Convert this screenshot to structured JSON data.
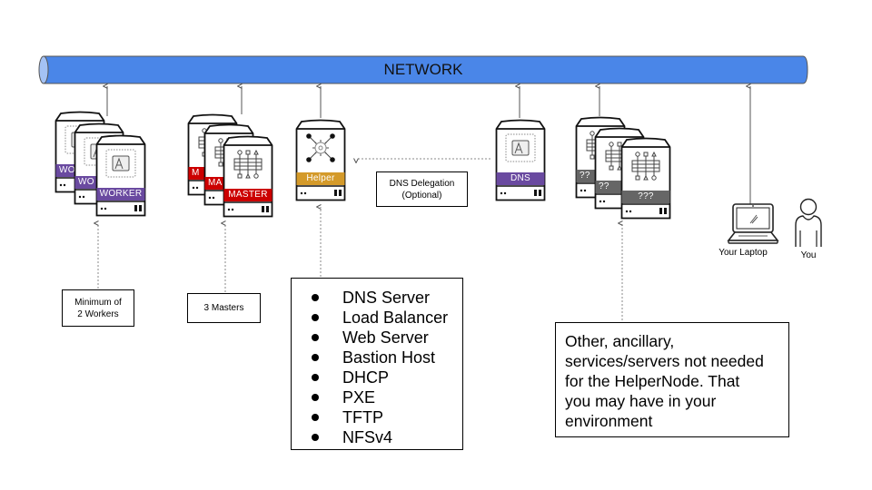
{
  "diagram": {
    "network": {
      "label": "NETWORK",
      "fill_color": "#4a86e8",
      "end_cap_color": "#a4c2f4"
    },
    "nodes": {
      "workers": {
        "label": "WORKER",
        "partial_labels": [
          "WO",
          "WO"
        ],
        "count_shown": 3,
        "band_color": "#6a4aa0",
        "icon": "container-app-icon"
      },
      "masters": {
        "label": "MASTER",
        "partial_labels": [
          "M",
          "MA"
        ],
        "count_shown": 3,
        "band_color": "#cc0000",
        "icon": "control-plane-icon"
      },
      "helper": {
        "label": "Helper",
        "band_color": "#d49a2a",
        "icon": "gear-network-icon"
      },
      "dns": {
        "label": "DNS",
        "band_color": "#6a4aa0",
        "icon": "container-app-icon"
      },
      "others": {
        "label": "???",
        "partial_labels": [
          "??",
          "??"
        ],
        "count_shown": 3,
        "band_color": "#666666",
        "icon": "control-plane-icon"
      },
      "laptop": {
        "label": "Your Laptop"
      },
      "user": {
        "label": "You"
      }
    },
    "notes": {
      "workers": "Minimum of\n2 Workers",
      "masters": "3 Masters",
      "dns_delegation": "DNS Delegation\n(Optional)",
      "other_services": "Other, ancillary,\nservices/servers not needed\nfor the HelperNode. That\nyou may have in your\nenvironment"
    },
    "helper_services": [
      "DNS Server",
      "Load Balancer",
      "Web Server",
      "Bastion Host",
      "DHCP",
      "PXE",
      "TFTP",
      "NFSv4"
    ]
  }
}
